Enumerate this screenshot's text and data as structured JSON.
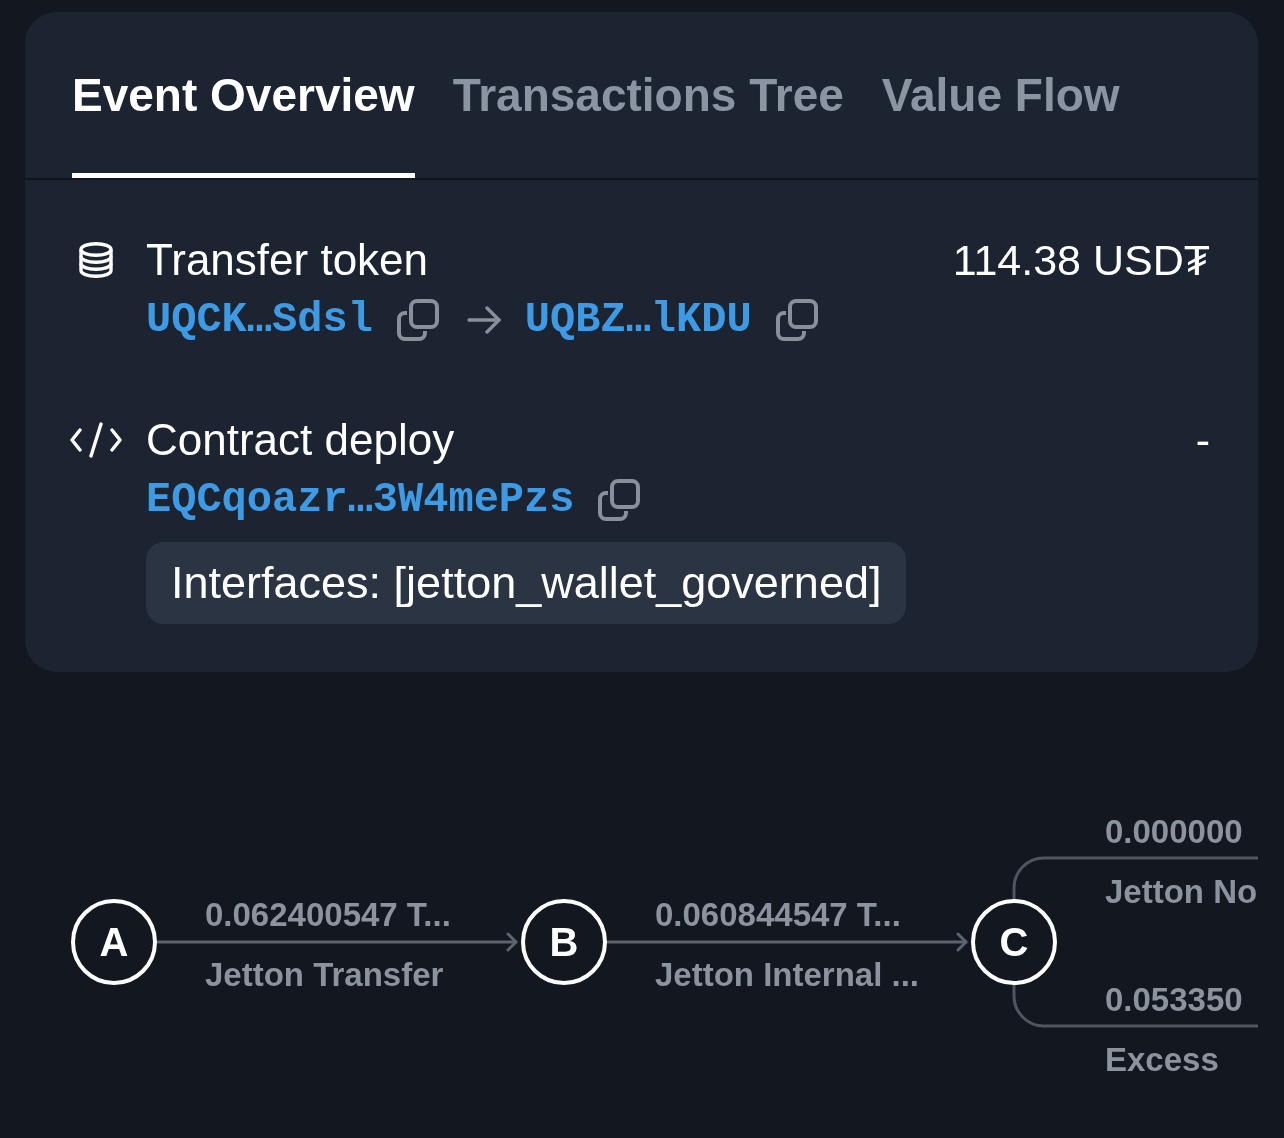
{
  "tabs": [
    {
      "label": "Event Overview",
      "selected": true
    },
    {
      "label": "Transactions Tree",
      "selected": false
    },
    {
      "label": "Value Flow",
      "selected": false
    }
  ],
  "events": [
    {
      "kind": "transfer",
      "title": "Transfer token",
      "amount": "114.38 USD₮",
      "addresses": [
        "UQCK…Sdsl",
        "UQBZ…lKDU"
      ]
    },
    {
      "kind": "deploy",
      "title": "Contract deploy",
      "amount": "-",
      "addresses": [
        "EQCqoazr…3W4mePzs"
      ],
      "interfaces": "Interfaces: [jetton_wallet_governed]"
    }
  ],
  "flow": {
    "nodes": [
      {
        "label": "A"
      },
      {
        "label": "B"
      },
      {
        "label": "C"
      }
    ],
    "edges": [
      {
        "amount": "0.062400547 T...",
        "label": "Jetton Transfer"
      },
      {
        "amount": "0.060844547 T...",
        "label": "Jetton Internal ..."
      }
    ],
    "branches": [
      {
        "amount": "0.000000",
        "label": "Jetton No"
      },
      {
        "amount": "0.053350",
        "label": "Excess"
      }
    ]
  }
}
